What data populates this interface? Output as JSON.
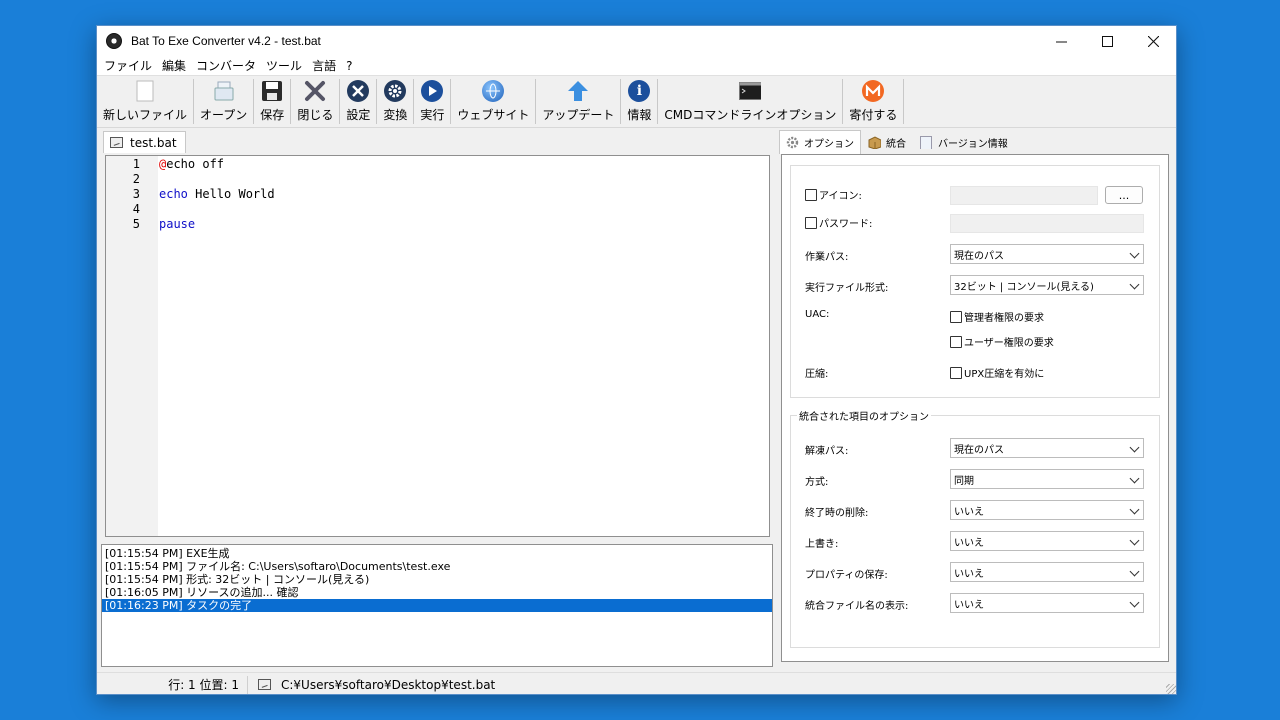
{
  "window": {
    "title": "Bat To Exe Converter v4.2 - test.bat",
    "controls": {
      "minimize": "—",
      "maximize": "☐",
      "close": "✕"
    }
  },
  "menu": [
    "ファイル",
    "編集",
    "コンバータ",
    "ツール",
    "言語",
    "?"
  ],
  "toolbar": [
    {
      "name": "new-file",
      "label": "新しいファイル",
      "icon": "blank-page-icon"
    },
    {
      "name": "open",
      "label": "オープン",
      "icon": "folder-icon"
    },
    {
      "name": "save",
      "label": "保存",
      "icon": "floppy-icon"
    },
    {
      "name": "close",
      "label": "閉じる",
      "icon": "x-icon"
    },
    {
      "name": "settings",
      "label": "設定",
      "icon": "tools-icon"
    },
    {
      "name": "convert",
      "label": "変換",
      "icon": "gear-icon"
    },
    {
      "name": "run",
      "label": "実行",
      "icon": "play-icon"
    },
    {
      "name": "website",
      "label": "ウェブサイト",
      "icon": "globe-icon"
    },
    {
      "name": "update",
      "label": "アップデート",
      "icon": "arrow-up-icon"
    },
    {
      "name": "info",
      "label": "情報",
      "icon": "info-icon"
    },
    {
      "name": "cmd-options",
      "label": "CMDコマンドラインオプション",
      "icon": "terminal-icon"
    },
    {
      "name": "donate",
      "label": "寄付する",
      "icon": "monero-icon"
    }
  ],
  "editor": {
    "tab_label": "test.bat",
    "lines": [
      {
        "num": "1",
        "parts": [
          [
            "@",
            "red"
          ],
          [
            "echo off",
            "plain"
          ]
        ]
      },
      {
        "num": "2",
        "parts": []
      },
      {
        "num": "3",
        "parts": [
          [
            "echo",
            "blue"
          ],
          [
            " Hello World",
            "plain"
          ]
        ]
      },
      {
        "num": "4",
        "parts": []
      },
      {
        "num": "5",
        "parts": [
          [
            "pause",
            "blue"
          ]
        ]
      }
    ]
  },
  "log": [
    {
      "text": "[01:15:54 PM] EXE生成",
      "selected": false
    },
    {
      "text": "[01:15:54 PM] ファイル名: C:\\Users\\softaro\\Documents\\test.exe",
      "selected": false
    },
    {
      "text": "[01:15:54 PM] 形式: 32ビット | コンソール(見える)",
      "selected": false
    },
    {
      "text": "[01:16:05 PM] リソースの追加... 確認",
      "selected": false
    },
    {
      "text": "[01:16:23 PM] タスクの完了",
      "selected": true
    }
  ],
  "right_panel": {
    "tabs": [
      "オプション",
      "統合",
      "バージョン情報"
    ],
    "options": {
      "icon_label": "アイコン:",
      "icon_browse": "...",
      "password_label": "パスワード:",
      "workdir_label": "作業パス:",
      "workdir_value": "現在のパス",
      "exe_format_label": "実行ファイル形式:",
      "exe_format_value": "32ビット | コンソール(見える)",
      "uac_label": "UAC:",
      "uac_admin": "管理者権限の要求",
      "uac_user": "ユーザー権限の要求",
      "compress_label": "圧縮:",
      "compress_upx": "UPX圧縮を有効に"
    },
    "embedded": {
      "title": "統合された項目のオプション",
      "extract_label": "解凍パス:",
      "extract_value": "現在のパス",
      "method_label": "方式:",
      "method_value": "同期",
      "delete_label": "終了時の削除:",
      "delete_value": "いいえ",
      "overwrite_label": "上書き:",
      "overwrite_value": "いいえ",
      "props_label": "プロパティの保存:",
      "props_value": "いいえ",
      "show_names_label": "統合ファイル名の表示:",
      "show_names_value": "いいえ"
    }
  },
  "status": {
    "position": "行: 1 位置: 1",
    "path": "C:¥Users¥softaro¥Desktop¥test.bat"
  }
}
